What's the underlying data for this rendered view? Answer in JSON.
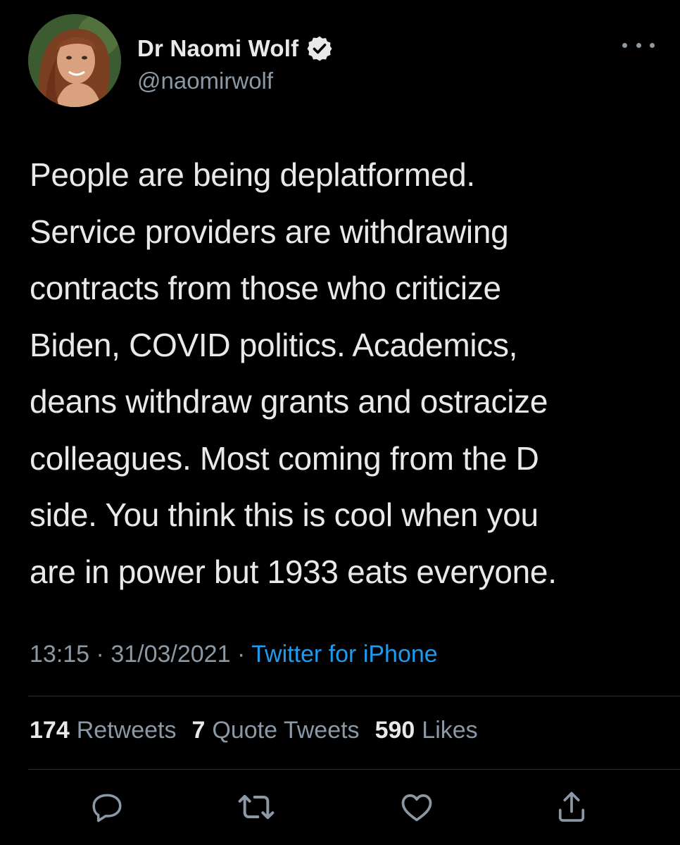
{
  "author": {
    "display_name": "Dr Naomi Wolf",
    "handle": "@naomirwolf",
    "verified": true
  },
  "tweet": {
    "text": "People are being deplatformed.\nService providers are withdrawing\ncontracts from those who criticize\nBiden, COVID politics. Academics,\ndeans withdraw grants and ostracize\ncolleagues. Most coming from the D\nside. You think this is cool when you\nare in power but 1933 eats everyone."
  },
  "meta": {
    "time": "13:15",
    "separator": "·",
    "date": "31/03/2021",
    "source": "Twitter for iPhone"
  },
  "stats": {
    "retweets_count": "174",
    "retweets_label": "Retweets",
    "quotes_count": "7",
    "quotes_label": "Quote Tweets",
    "likes_count": "590",
    "likes_label": "Likes"
  },
  "actions": [
    "reply-icon",
    "retweet-icon",
    "like-icon",
    "share-icon"
  ],
  "colors": {
    "background": "#000000",
    "text": "#e7e9ea",
    "secondary": "#8b98a5",
    "link": "#1d9bf0",
    "divider": "#2f3336"
  }
}
